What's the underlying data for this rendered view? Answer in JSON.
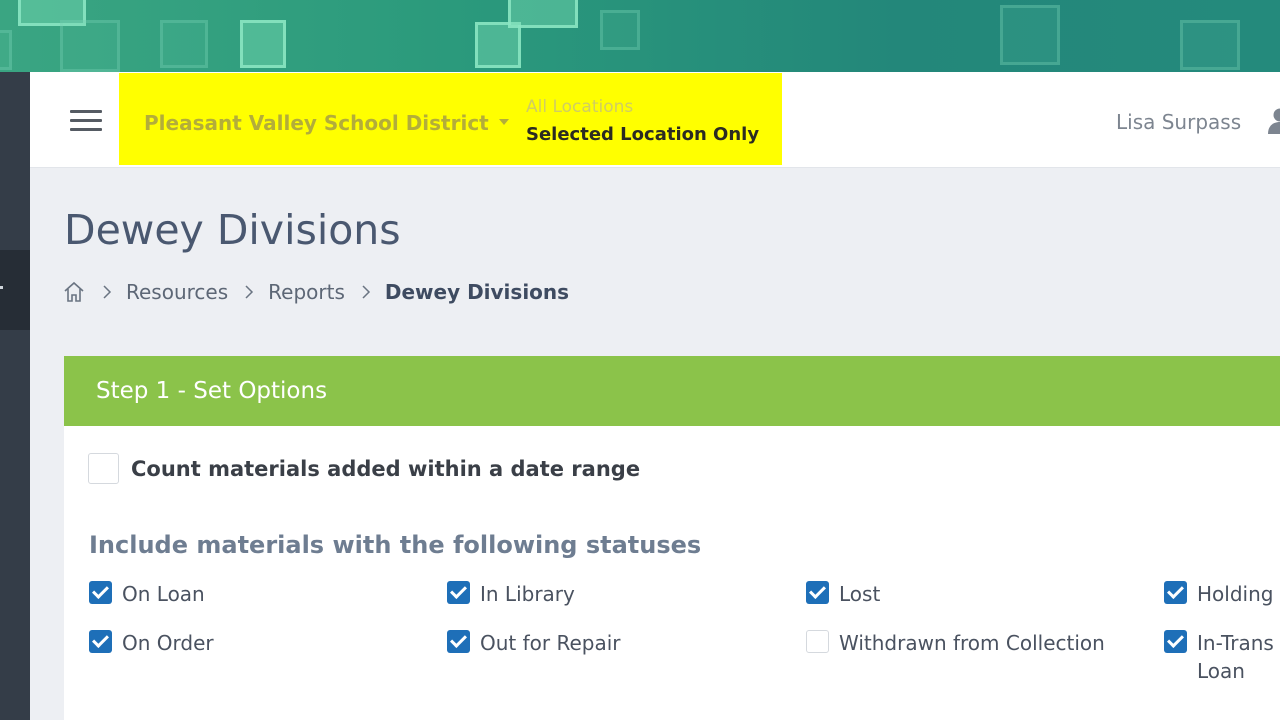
{
  "header": {
    "district": "Pleasant Valley School District",
    "location_options": [
      "All Locations",
      "Selected Location Only"
    ],
    "user_name": "Lisa Surpass"
  },
  "page": {
    "title": "Dewey Divisions",
    "breadcrumb": [
      "Resources",
      "Reports",
      "Dewey Divisions"
    ]
  },
  "step": {
    "title": "Step 1 - Set Options",
    "date_range_label": "Count materials added within a date range",
    "date_range_checked": false,
    "statuses_heading": "Include materials with the following statuses",
    "statuses": [
      {
        "label": "On Loan",
        "checked": true
      },
      {
        "label": "In Library",
        "checked": true
      },
      {
        "label": "Lost",
        "checked": true
      },
      {
        "label": "Holding",
        "checked": true
      },
      {
        "label": "On Order",
        "checked": true
      },
      {
        "label": "Out for Repair",
        "checked": true
      },
      {
        "label": "Withdrawn from Collection",
        "checked": false
      },
      {
        "label": "In-Trans\nLoan",
        "checked": true
      }
    ]
  },
  "colors": {
    "highlight": "#ffff00",
    "step_header": "#8bc34a",
    "checkbox": "#1e6fb8"
  }
}
